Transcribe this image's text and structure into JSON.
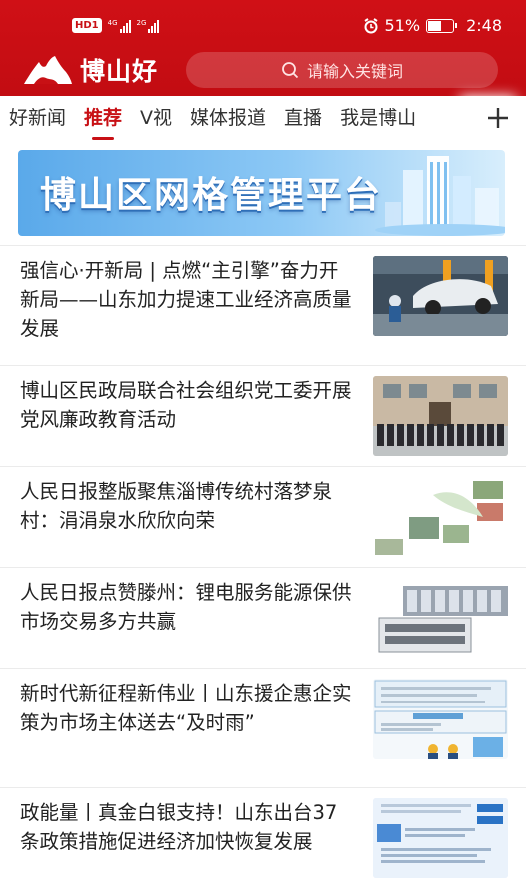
{
  "status_bar": {
    "network_badge": "HD",
    "sim": "1",
    "signal_1": "4G",
    "signal_2": "2G",
    "battery": "51%",
    "time": "2:48"
  },
  "header": {
    "app_name": "博山好",
    "search_placeholder": "请输入关键词"
  },
  "tabs": [
    {
      "label": "好新闻"
    },
    {
      "label": "推荐"
    },
    {
      "label": "V视"
    },
    {
      "label": "媒体报道"
    },
    {
      "label": "直播"
    },
    {
      "label": "我是博山"
    }
  ],
  "active_tab": "推荐",
  "banner": {
    "title": "博山区网格管理平台"
  },
  "news": [
    {
      "title": "强信心·开新局 | 点燃“主引擎”奋力开新局——山东加力提速工业经济高质量发展",
      "thumb": "car-factory-icon"
    },
    {
      "title": "博山区民政局联合社会组织党工委开展党风廉政教育活动",
      "thumb": "group-photo-icon"
    },
    {
      "title": "人民日报整版聚焦淄博传统村落梦泉村：涓涓泉水欣欣向荣",
      "thumb": "village-photos-icon"
    },
    {
      "title": "人民日报点赞滕州：锂电服务能源保供市场交易多方共赢",
      "thumb": "battery-equipment-icon"
    },
    {
      "title": "新时代新征程新伟业丨山东援企惠企实策为市场主体送去“及时雨”",
      "thumb": "infographic-icon"
    },
    {
      "title": "政能量丨真金白银支持！山东出台37条政策措施促进经济加快恢复发展",
      "thumb": "policy-infographic-icon"
    }
  ],
  "colors": {
    "brand_red": "#c81015",
    "text": "#222222",
    "banner_blue": "#5aa9ea"
  }
}
